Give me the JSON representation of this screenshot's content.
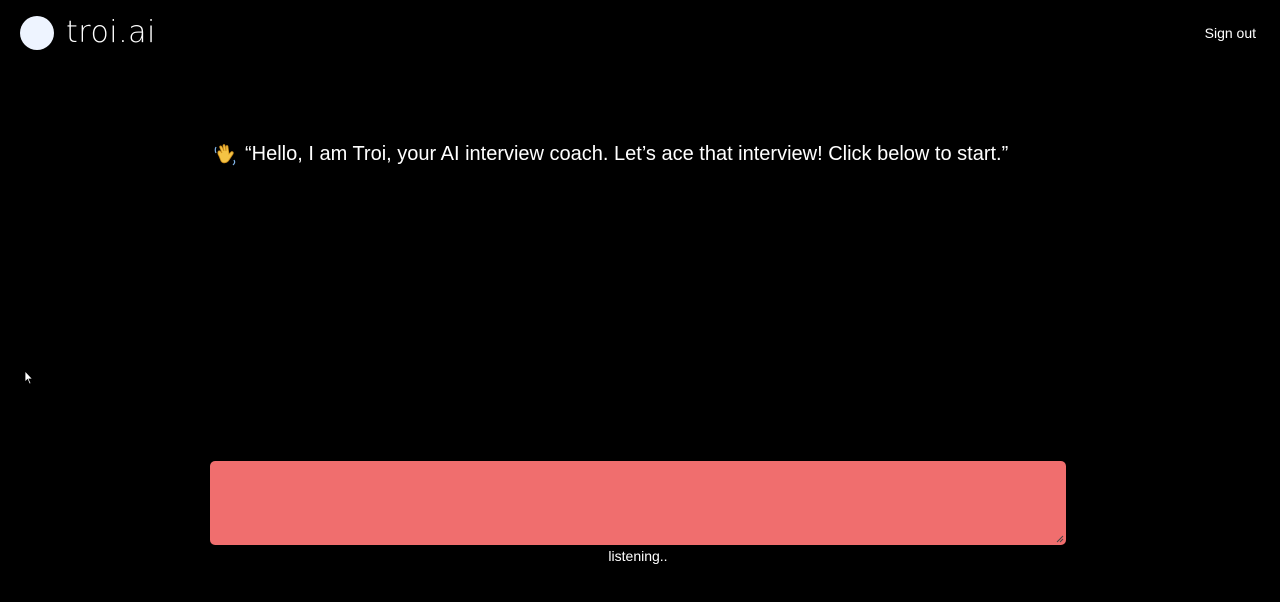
{
  "header": {
    "logo_text": "troi.ai",
    "signout_label": "Sign out"
  },
  "greeting": {
    "icon": "waving-hand-icon",
    "text": "“Hello, I am Troi, your AI interview coach. Let’s ace that interview! Click below to start.”"
  },
  "recorder": {
    "status": "listening.."
  },
  "colors": {
    "background": "#000000",
    "text": "#ffffff",
    "record_box": "#f06e6e",
    "logo_circle": "#eef4ff"
  }
}
